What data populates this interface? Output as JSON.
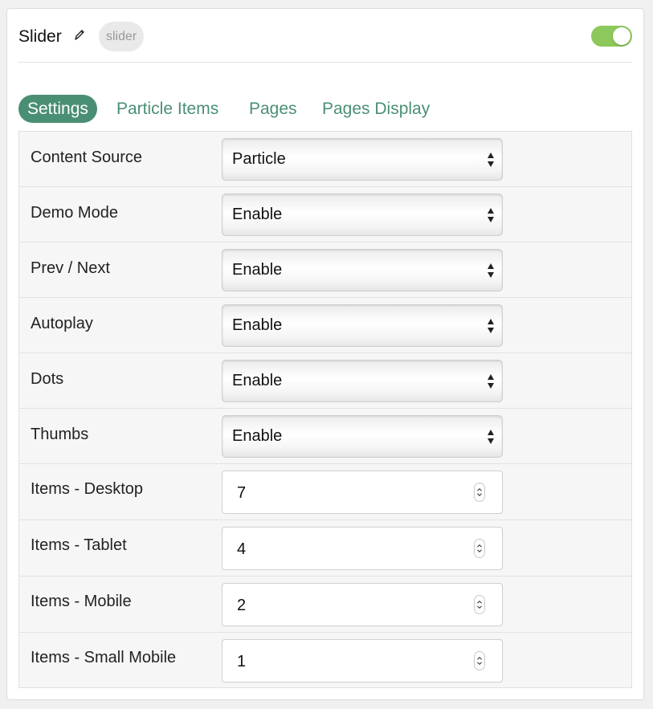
{
  "header": {
    "title": "Slider",
    "badge": "slider",
    "enabled": true,
    "icons": {
      "edit": "pencil-icon"
    }
  },
  "tabs": [
    {
      "label": "Settings",
      "active": true
    },
    {
      "label": "Particle Items",
      "active": false
    },
    {
      "label": "Pages",
      "active": false
    },
    {
      "label": "Pages Display",
      "active": false
    }
  ],
  "settings": {
    "content_source": {
      "label": "Content Source",
      "value": "Particle"
    },
    "demo_mode": {
      "label": "Demo Mode",
      "value": "Enable"
    },
    "prev_next": {
      "label": "Prev / Next",
      "value": "Enable"
    },
    "autoplay": {
      "label": "Autoplay",
      "value": "Enable"
    },
    "dots": {
      "label": "Dots",
      "value": "Enable"
    },
    "thumbs": {
      "label": "Thumbs",
      "value": "Enable"
    },
    "items_desktop": {
      "label": "Items - Desktop",
      "value": "7"
    },
    "items_tablet": {
      "label": "Items - Tablet",
      "value": "4"
    },
    "items_mobile": {
      "label": "Items - Mobile",
      "value": "2"
    },
    "items_small_mobile": {
      "label": "Items - Small Mobile",
      "value": "1"
    }
  },
  "colors": {
    "accent": "#4a8f74",
    "toggle_on": "#8cc85b"
  }
}
